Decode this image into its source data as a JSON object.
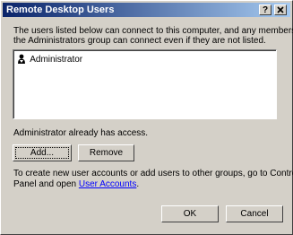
{
  "dialog": {
    "title": "Remote Desktop Users",
    "help_button": "?",
    "close_button": "✕"
  },
  "description": {
    "line1": "The users listed below can connect to this computer, and any members of",
    "line2": "the Administrators group can connect even if they are not listed."
  },
  "users_list": {
    "items": [
      {
        "label": "Administrator",
        "icon": "user-icon"
      }
    ]
  },
  "access_status": "Administrator already has access.",
  "buttons": {
    "add": "Add...",
    "remove": "Remove",
    "ok": "OK",
    "cancel": "Cancel"
  },
  "footer": {
    "line1": "To create new user accounts or add users to other groups, go to Control",
    "line2_prefix": "Panel and open",
    "link": "User Accounts",
    "line2_suffix": "."
  }
}
